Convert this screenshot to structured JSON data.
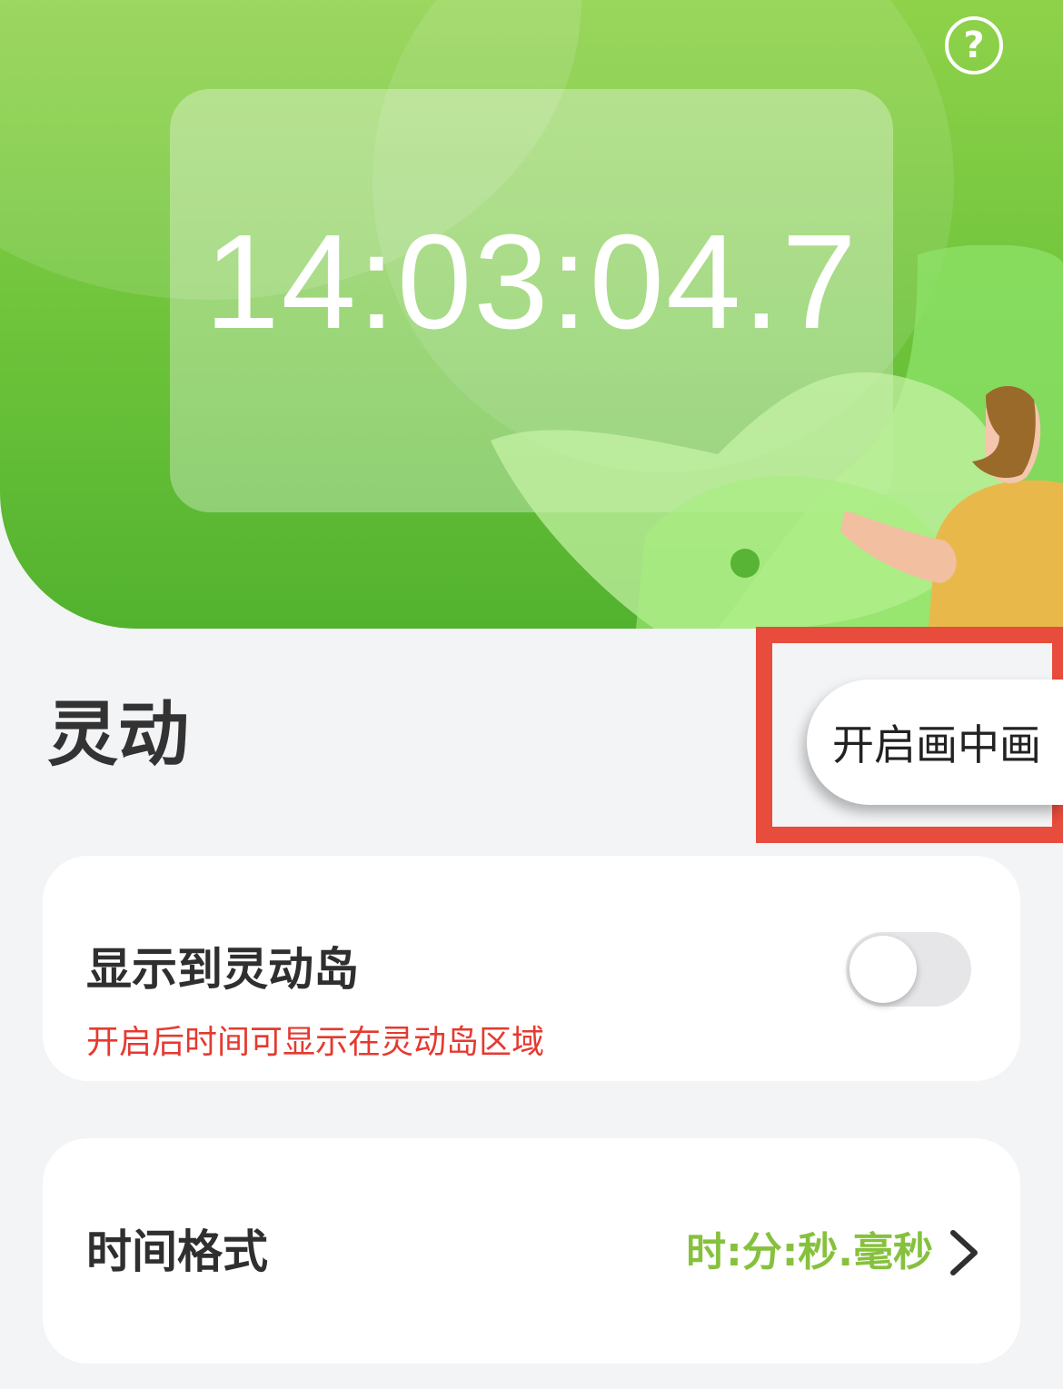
{
  "hero": {
    "clock": "14:03:04.7",
    "help_symbol": "?"
  },
  "section": {
    "title": "灵动",
    "pip_button_label": "开启画中画"
  },
  "settings": {
    "dynamic_island": {
      "title": "显示到灵动岛",
      "description": "开启后时间可显示在灵动岛区域",
      "enabled": false
    },
    "time_format": {
      "title": "时间格式",
      "value": "时:分:秒.毫秒"
    }
  },
  "colors": {
    "accent": "#86c13d",
    "warning": "#e53a30",
    "highlight": "#e74c3c"
  }
}
